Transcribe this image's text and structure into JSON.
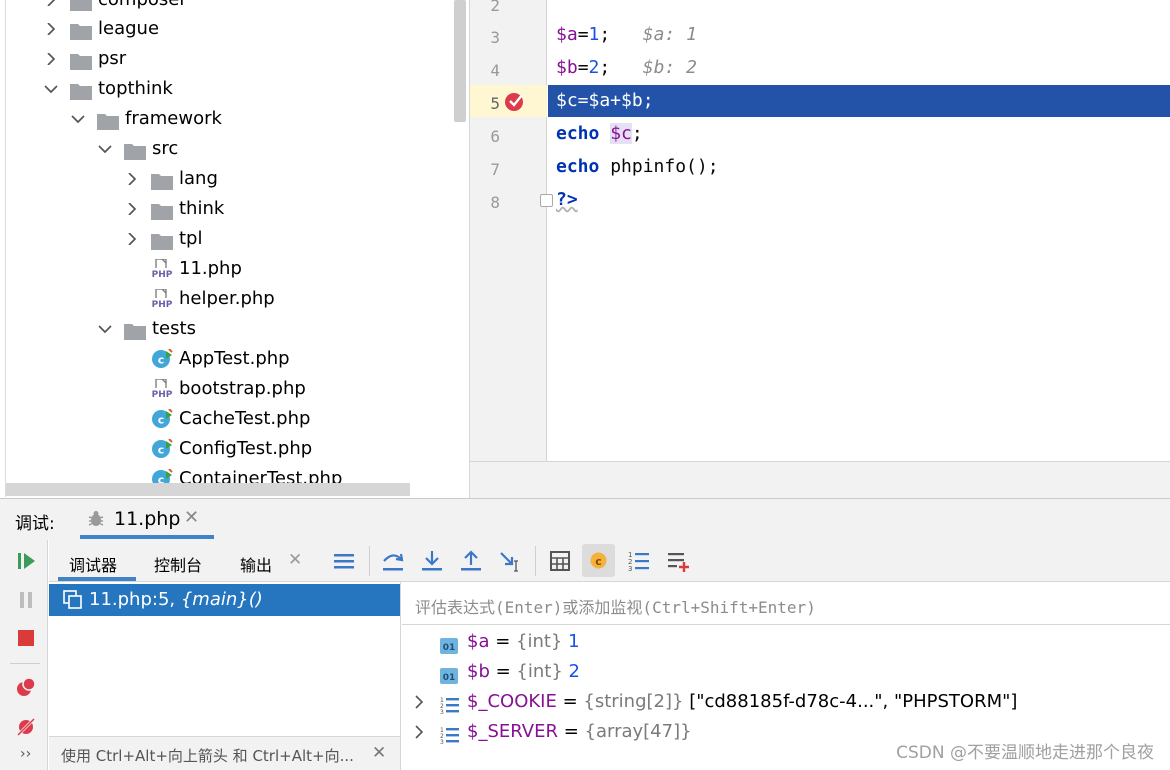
{
  "project_tree": {
    "items": [
      {
        "label": "composer",
        "expanded": false,
        "type": "folder"
      },
      {
        "label": "league",
        "expanded": false,
        "type": "folder"
      },
      {
        "label": "psr",
        "expanded": false,
        "type": "folder"
      },
      {
        "label": "topthink",
        "expanded": true,
        "type": "folder"
      },
      {
        "label": "framework",
        "expanded": true,
        "type": "folder"
      },
      {
        "label": "src",
        "expanded": true,
        "type": "folder"
      },
      {
        "label": "lang",
        "expanded": false,
        "type": "folder"
      },
      {
        "label": "think",
        "expanded": false,
        "type": "folder"
      },
      {
        "label": "tpl",
        "expanded": false,
        "type": "folder"
      },
      {
        "label": "11.php",
        "type": "php-file"
      },
      {
        "label": "helper.php",
        "type": "php-file"
      },
      {
        "label": "tests",
        "expanded": true,
        "type": "folder"
      },
      {
        "label": "AppTest.php",
        "type": "php-class-file"
      },
      {
        "label": "bootstrap.php",
        "type": "php-file"
      },
      {
        "label": "CacheTest.php",
        "type": "php-class-file"
      },
      {
        "label": "ConfigTest.php",
        "type": "php-class-file"
      },
      {
        "label": "ContainerTest.php",
        "type": "php-class-file"
      }
    ]
  },
  "editor": {
    "line_numbers": [
      "2",
      "3",
      "4",
      "5",
      "6",
      "7",
      "8"
    ],
    "code": {
      "l3": {
        "var": "$a",
        "op": "=",
        "num": "1",
        "end": ";",
        "hint": "$a: 1"
      },
      "l4": {
        "var": "$b",
        "op": "=",
        "num": "2",
        "end": ";",
        "hint": "$b: 2"
      },
      "l5": {
        "text": "$c=$a+$b;"
      },
      "l6": {
        "kw": "echo",
        "var": "$c",
        "end": ";"
      },
      "l7": {
        "kw": "echo",
        "rest": "phpinfo();"
      },
      "l8": {
        "kw": "?>"
      }
    },
    "current_line": "5",
    "colors": {
      "highlight": "#2253a9",
      "keyword": "#0033b3",
      "variable": "#871094",
      "number": "#1750eb"
    }
  },
  "debug": {
    "title": "调试:",
    "session_tab": "11.php",
    "subtabs": [
      "调试器",
      "控制台",
      "输出"
    ],
    "frame": {
      "file": "11.php:5,",
      "func": "{main}()"
    },
    "frames_hint": "使用 Ctrl+Alt+向上箭头 和 Ctrl+Alt+向...",
    "eval_placeholder": "评估表达式(Enter)或添加监视(Ctrl+Shift+Enter)",
    "variables": [
      {
        "name": "$a",
        "eq": " = ",
        "type": "{int}",
        "value": "1",
        "expandable": false
      },
      {
        "name": "$b",
        "eq": " = ",
        "type": "{int}",
        "value": "2",
        "expandable": false
      },
      {
        "name": "$_COOKIE",
        "eq": " = ",
        "type": "{string[2]}",
        "value": "[\"cd88185f-d78c-4...\", \"PHPSTORM\"]",
        "expandable": true
      },
      {
        "name": "$_SERVER",
        "eq": " = ",
        "type": "{array[47]}",
        "value": "",
        "expandable": true
      }
    ]
  },
  "watermark": "CSDN @不要温顺地走进那个良夜"
}
